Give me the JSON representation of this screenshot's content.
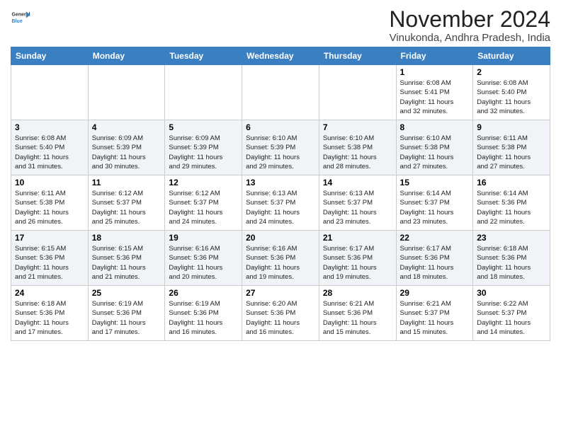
{
  "header": {
    "logo_line1": "General",
    "logo_line2": "Blue",
    "month_title": "November 2024",
    "location": "Vinukonda, Andhra Pradesh, India"
  },
  "weekdays": [
    "Sunday",
    "Monday",
    "Tuesday",
    "Wednesday",
    "Thursday",
    "Friday",
    "Saturday"
  ],
  "weeks": [
    [
      {
        "day": "",
        "info": ""
      },
      {
        "day": "",
        "info": ""
      },
      {
        "day": "",
        "info": ""
      },
      {
        "day": "",
        "info": ""
      },
      {
        "day": "",
        "info": ""
      },
      {
        "day": "1",
        "info": "Sunrise: 6:08 AM\nSunset: 5:41 PM\nDaylight: 11 hours\nand 32 minutes."
      },
      {
        "day": "2",
        "info": "Sunrise: 6:08 AM\nSunset: 5:40 PM\nDaylight: 11 hours\nand 32 minutes."
      }
    ],
    [
      {
        "day": "3",
        "info": "Sunrise: 6:08 AM\nSunset: 5:40 PM\nDaylight: 11 hours\nand 31 minutes."
      },
      {
        "day": "4",
        "info": "Sunrise: 6:09 AM\nSunset: 5:39 PM\nDaylight: 11 hours\nand 30 minutes."
      },
      {
        "day": "5",
        "info": "Sunrise: 6:09 AM\nSunset: 5:39 PM\nDaylight: 11 hours\nand 29 minutes."
      },
      {
        "day": "6",
        "info": "Sunrise: 6:10 AM\nSunset: 5:39 PM\nDaylight: 11 hours\nand 29 minutes."
      },
      {
        "day": "7",
        "info": "Sunrise: 6:10 AM\nSunset: 5:38 PM\nDaylight: 11 hours\nand 28 minutes."
      },
      {
        "day": "8",
        "info": "Sunrise: 6:10 AM\nSunset: 5:38 PM\nDaylight: 11 hours\nand 27 minutes."
      },
      {
        "day": "9",
        "info": "Sunrise: 6:11 AM\nSunset: 5:38 PM\nDaylight: 11 hours\nand 27 minutes."
      }
    ],
    [
      {
        "day": "10",
        "info": "Sunrise: 6:11 AM\nSunset: 5:38 PM\nDaylight: 11 hours\nand 26 minutes."
      },
      {
        "day": "11",
        "info": "Sunrise: 6:12 AM\nSunset: 5:37 PM\nDaylight: 11 hours\nand 25 minutes."
      },
      {
        "day": "12",
        "info": "Sunrise: 6:12 AM\nSunset: 5:37 PM\nDaylight: 11 hours\nand 24 minutes."
      },
      {
        "day": "13",
        "info": "Sunrise: 6:13 AM\nSunset: 5:37 PM\nDaylight: 11 hours\nand 24 minutes."
      },
      {
        "day": "14",
        "info": "Sunrise: 6:13 AM\nSunset: 5:37 PM\nDaylight: 11 hours\nand 23 minutes."
      },
      {
        "day": "15",
        "info": "Sunrise: 6:14 AM\nSunset: 5:37 PM\nDaylight: 11 hours\nand 23 minutes."
      },
      {
        "day": "16",
        "info": "Sunrise: 6:14 AM\nSunset: 5:36 PM\nDaylight: 11 hours\nand 22 minutes."
      }
    ],
    [
      {
        "day": "17",
        "info": "Sunrise: 6:15 AM\nSunset: 5:36 PM\nDaylight: 11 hours\nand 21 minutes."
      },
      {
        "day": "18",
        "info": "Sunrise: 6:15 AM\nSunset: 5:36 PM\nDaylight: 11 hours\nand 21 minutes."
      },
      {
        "day": "19",
        "info": "Sunrise: 6:16 AM\nSunset: 5:36 PM\nDaylight: 11 hours\nand 20 minutes."
      },
      {
        "day": "20",
        "info": "Sunrise: 6:16 AM\nSunset: 5:36 PM\nDaylight: 11 hours\nand 19 minutes."
      },
      {
        "day": "21",
        "info": "Sunrise: 6:17 AM\nSunset: 5:36 PM\nDaylight: 11 hours\nand 19 minutes."
      },
      {
        "day": "22",
        "info": "Sunrise: 6:17 AM\nSunset: 5:36 PM\nDaylight: 11 hours\nand 18 minutes."
      },
      {
        "day": "23",
        "info": "Sunrise: 6:18 AM\nSunset: 5:36 PM\nDaylight: 11 hours\nand 18 minutes."
      }
    ],
    [
      {
        "day": "24",
        "info": "Sunrise: 6:18 AM\nSunset: 5:36 PM\nDaylight: 11 hours\nand 17 minutes."
      },
      {
        "day": "25",
        "info": "Sunrise: 6:19 AM\nSunset: 5:36 PM\nDaylight: 11 hours\nand 17 minutes."
      },
      {
        "day": "26",
        "info": "Sunrise: 6:19 AM\nSunset: 5:36 PM\nDaylight: 11 hours\nand 16 minutes."
      },
      {
        "day": "27",
        "info": "Sunrise: 6:20 AM\nSunset: 5:36 PM\nDaylight: 11 hours\nand 16 minutes."
      },
      {
        "day": "28",
        "info": "Sunrise: 6:21 AM\nSunset: 5:36 PM\nDaylight: 11 hours\nand 15 minutes."
      },
      {
        "day": "29",
        "info": "Sunrise: 6:21 AM\nSunset: 5:37 PM\nDaylight: 11 hours\nand 15 minutes."
      },
      {
        "day": "30",
        "info": "Sunrise: 6:22 AM\nSunset: 5:37 PM\nDaylight: 11 hours\nand 14 minutes."
      }
    ]
  ]
}
